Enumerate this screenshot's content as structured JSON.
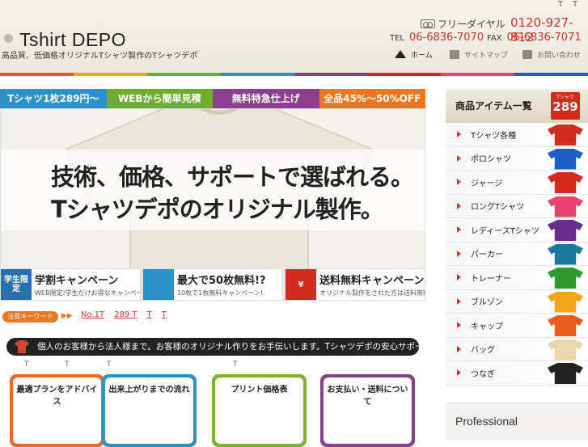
{
  "top_marks": [
    "T",
    "T"
  ],
  "logo": {
    "text": "Tshirt DEPO",
    "tagline": "高品質、低価格オリジナルTシャツ製作のTシャツデポ"
  },
  "contact": {
    "freedial_label": "フリーダイヤル",
    "freedial_number": "0120-927-812",
    "tel_label": "TEL",
    "tel_number": "06-6836-7070",
    "fax_label": "FAX",
    "fax_number": "06-6836-7071"
  },
  "nav": {
    "home": "ホーム",
    "sitemap": "サイトマップ",
    "contact": "お問い合わせ"
  },
  "banner_tabs": [
    {
      "label": "Tシャツ1枚289円〜",
      "color": "#2a91c9"
    },
    {
      "label": "WEBから簡単見積",
      "color": "#6dae2d"
    },
    {
      "label": "無料特急仕上げ",
      "color": "#8a3f8f"
    },
    {
      "label": "全品45%〜50%OFF",
      "color": "#f0761e"
    }
  ],
  "hero": {
    "line1": "技術、価格、サポートで選ばれる。",
    "line2": "Tシャツデポのオリジナル製作。"
  },
  "promos": [
    {
      "badge": "学生限定",
      "title": "学割キャンペーン",
      "sub": "WEB限定!学生だけお得なキャンペーン!",
      "color": "#2a6fad"
    },
    {
      "badge": "",
      "title": "最大で50枚無料!?",
      "sub": "10枚で1枚無料キャンペーン!",
      "color": "#2a91c9"
    },
    {
      "badge": "¥",
      "title": "送料無料キャンペーン",
      "sub": "オリジナル製作をされた方は送料無料!",
      "color": "#d42b1f"
    }
  ],
  "keywords": {
    "button": "注目キーワード",
    "arrow": "▶▶",
    "links": [
      "No.1T",
      "289 T",
      "T",
      "T"
    ]
  },
  "support_bar": "個人のお客様から法人様まで。お客様のオリジナル作りをお手伝いします。Tシャツデポの安心サポート",
  "small_marks": [
    "T",
    "T",
    "T",
    "T"
  ],
  "cards": [
    {
      "title": "最適プランをアドバイス",
      "color": "#e96a2a"
    },
    {
      "title": "出来上がりまでの流れ",
      "color": "#2a91c9"
    },
    {
      "title": "プリント価格表",
      "color": "#7cb42a"
    },
    {
      "title": "お支払い・送料について",
      "color": "#8a3f8f"
    }
  ],
  "sidebar": {
    "heading": "商品アイテム一覧",
    "badge_small": "Tシャツ",
    "badge_price": "289",
    "items": [
      {
        "label": "Tシャツ各種",
        "color": "#d42b1f"
      },
      {
        "label": "ポロシャツ",
        "color": "#1c5fc4"
      },
      {
        "label": "ジャージ",
        "color": "#d42b1f"
      },
      {
        "label": "ロングTシャツ",
        "color": "#e8436a"
      },
      {
        "label": "レディースTシャツ",
        "color": "#6a2d8e"
      },
      {
        "label": "パーカー",
        "color": "#1a7a9c"
      },
      {
        "label": "トレーナー",
        "color": "#2e9a2e"
      },
      {
        "label": "ブルゾン",
        "color": "#f2a51c"
      },
      {
        "label": "キャップ",
        "color": "#e85a1e"
      },
      {
        "label": "バッグ",
        "color": "#e9d7a8"
      },
      {
        "label": "つなぎ",
        "color": "#222222"
      }
    ],
    "professional": "Professional"
  },
  "stripe_colors": [
    "#e85a1e",
    "#f2a51c",
    "#6dae2d",
    "#2a91c9",
    "#8a3f8f",
    "#d42b1f",
    "#e8436a",
    "#1c5fc4"
  ]
}
